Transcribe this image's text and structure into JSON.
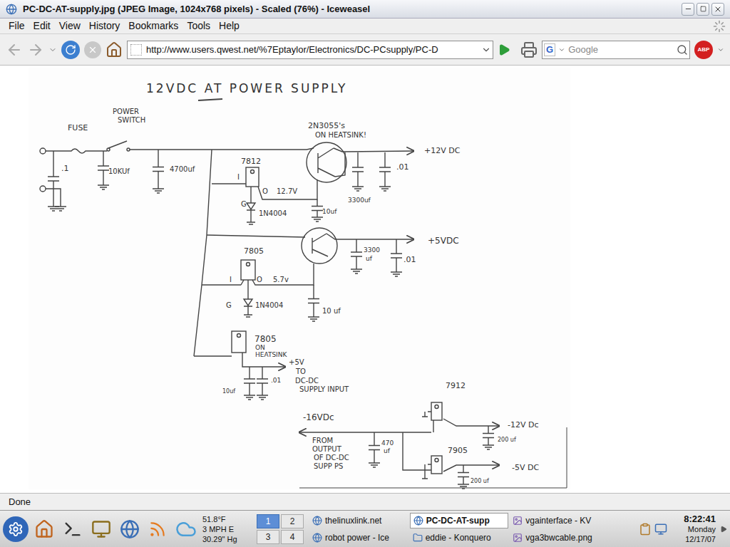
{
  "window": {
    "title": "PC-DC-AT-supply.jpg (JPEG Image, 1024x768 pixels) - Scaled (76%) - Iceweasel"
  },
  "menu": [
    "File",
    "Edit",
    "View",
    "History",
    "Bookmarks",
    "Tools",
    "Help"
  ],
  "toolbar": {
    "url": "http://www.users.qwest.net/%7Eptaylor/Electronics/DC-PCsupply/PC-D",
    "search_engine": "G",
    "search_placeholder": "Google",
    "adblock": "ABP"
  },
  "schematic": {
    "title": "12VDC AT POWER SUPPLY",
    "labels": [
      "FUSE",
      "POWER",
      "SWITCH",
      "2N3055's",
      "ON HEATSINK!",
      "+12V DC",
      ".1",
      "10KUf",
      "4700uf",
      "7812",
      "I",
      "O",
      "12.7V",
      "G",
      "1N4004",
      "3300uf",
      ".01",
      "10uf",
      "+5VDC",
      "3300",
      "uf",
      ".01",
      "7805",
      "I",
      "O",
      "5.7v",
      "G",
      "1N4004",
      "10 uf",
      "7805",
      "ON",
      "HEATSINK",
      "+5V",
      "TO",
      "DC-DC",
      "SUPPLY INPUT",
      "10uf",
      ".01",
      "7912",
      "-16VDc",
      "FROM",
      "OUTPUT",
      "OF DC-DC",
      "SUPP PS",
      "470",
      "uf",
      "-12V Dc",
      "200 uf",
      "7905",
      "-5V DC",
      "200 uf"
    ]
  },
  "status_bar": {
    "text": "Done"
  },
  "taskbar": {
    "weather": [
      "51.8°F",
      "3 MPH E",
      "30.29\" Hg"
    ],
    "desktops": [
      {
        "label": "1",
        "selected": true
      },
      {
        "label": "2",
        "selected": false
      },
      {
        "label": "3",
        "selected": false
      },
      {
        "label": "4",
        "selected": false
      }
    ],
    "tasks": [
      {
        "label": "thelinuxlink.net",
        "active": false
      },
      {
        "label": "PC-DC-AT-supp",
        "active": true
      },
      {
        "label": "vgainterface - KV",
        "active": false
      },
      {
        "label": "robot power - Ice",
        "active": false
      },
      {
        "label": "eddie - Konquero",
        "active": false
      },
      {
        "label": "vga3bwcable.png",
        "active": false
      }
    ],
    "clock": {
      "time": "8:22:41",
      "day": "Monday",
      "date": "12/17/07"
    }
  }
}
